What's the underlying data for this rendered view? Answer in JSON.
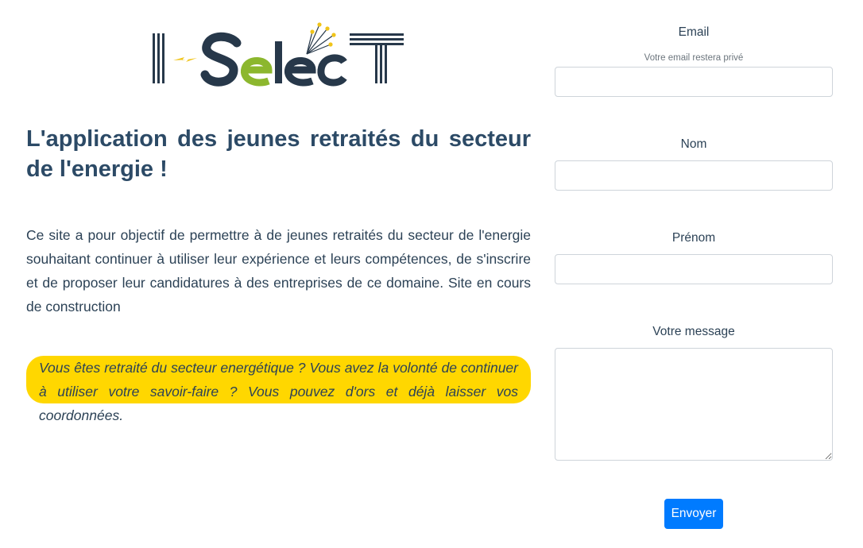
{
  "logo": {
    "text": "I-SelecT",
    "colors": {
      "dark": "#27384a",
      "green": "#8cb72e",
      "yellow": "#f0c419"
    }
  },
  "headline": "L'application des jeunes retraités du secteur de l'energie !",
  "intro": "Ce site a pour objectif de permettre à de jeunes retraités du secteur de l'energie souhaitant continuer à utiliser leur expérience et leurs compétences, de s'inscrire et de proposer leur candidatures à des entreprises de ce domaine. Site en cours de construction",
  "callout": "Vous êtes retraité du secteur energétique ? Vous avez la volonté de continuer à utiliser votre savoir-faire ? Vous pouvez d'ors et déjà laisser vos coordonnées.",
  "form": {
    "email_label": "Email",
    "email_help": "Votre email restera privé",
    "email_value": "",
    "nom_label": "Nom",
    "nom_value": "",
    "prenom_label": "Prénom",
    "prenom_value": "",
    "message_label": "Votre message",
    "message_value": "",
    "submit_label": "Envoyer"
  },
  "colors": {
    "accent": "#007bff",
    "highlight": "#ffd700",
    "text": "#2c4256"
  }
}
